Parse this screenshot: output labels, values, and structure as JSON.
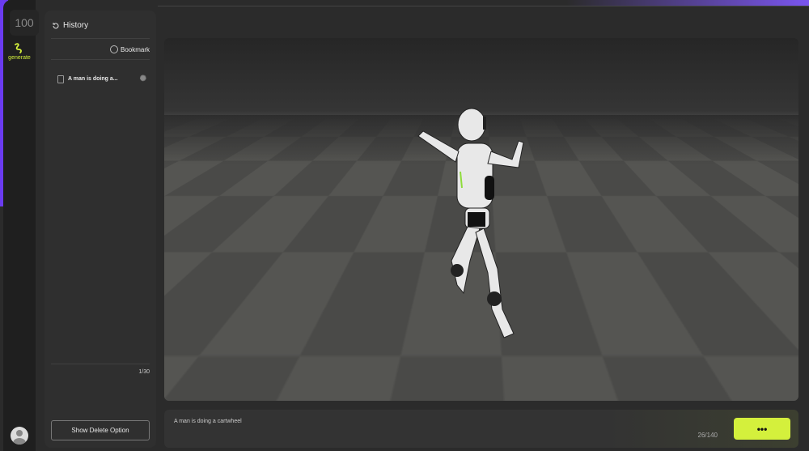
{
  "rail": {
    "credit": "100",
    "generate_label": "generate"
  },
  "history": {
    "title": "History",
    "bookmark_label": "Bookmark",
    "items": [
      {
        "label": "A man is doing a..."
      }
    ],
    "pagination": "1/30",
    "delete_button": "Show Delete Option"
  },
  "prompt": {
    "text": "A man is doing a cartwheel",
    "char_count": "26/140",
    "send_label": "•••"
  },
  "colors": {
    "accent": "#d4f03c",
    "brand": "#6b3bf0"
  }
}
